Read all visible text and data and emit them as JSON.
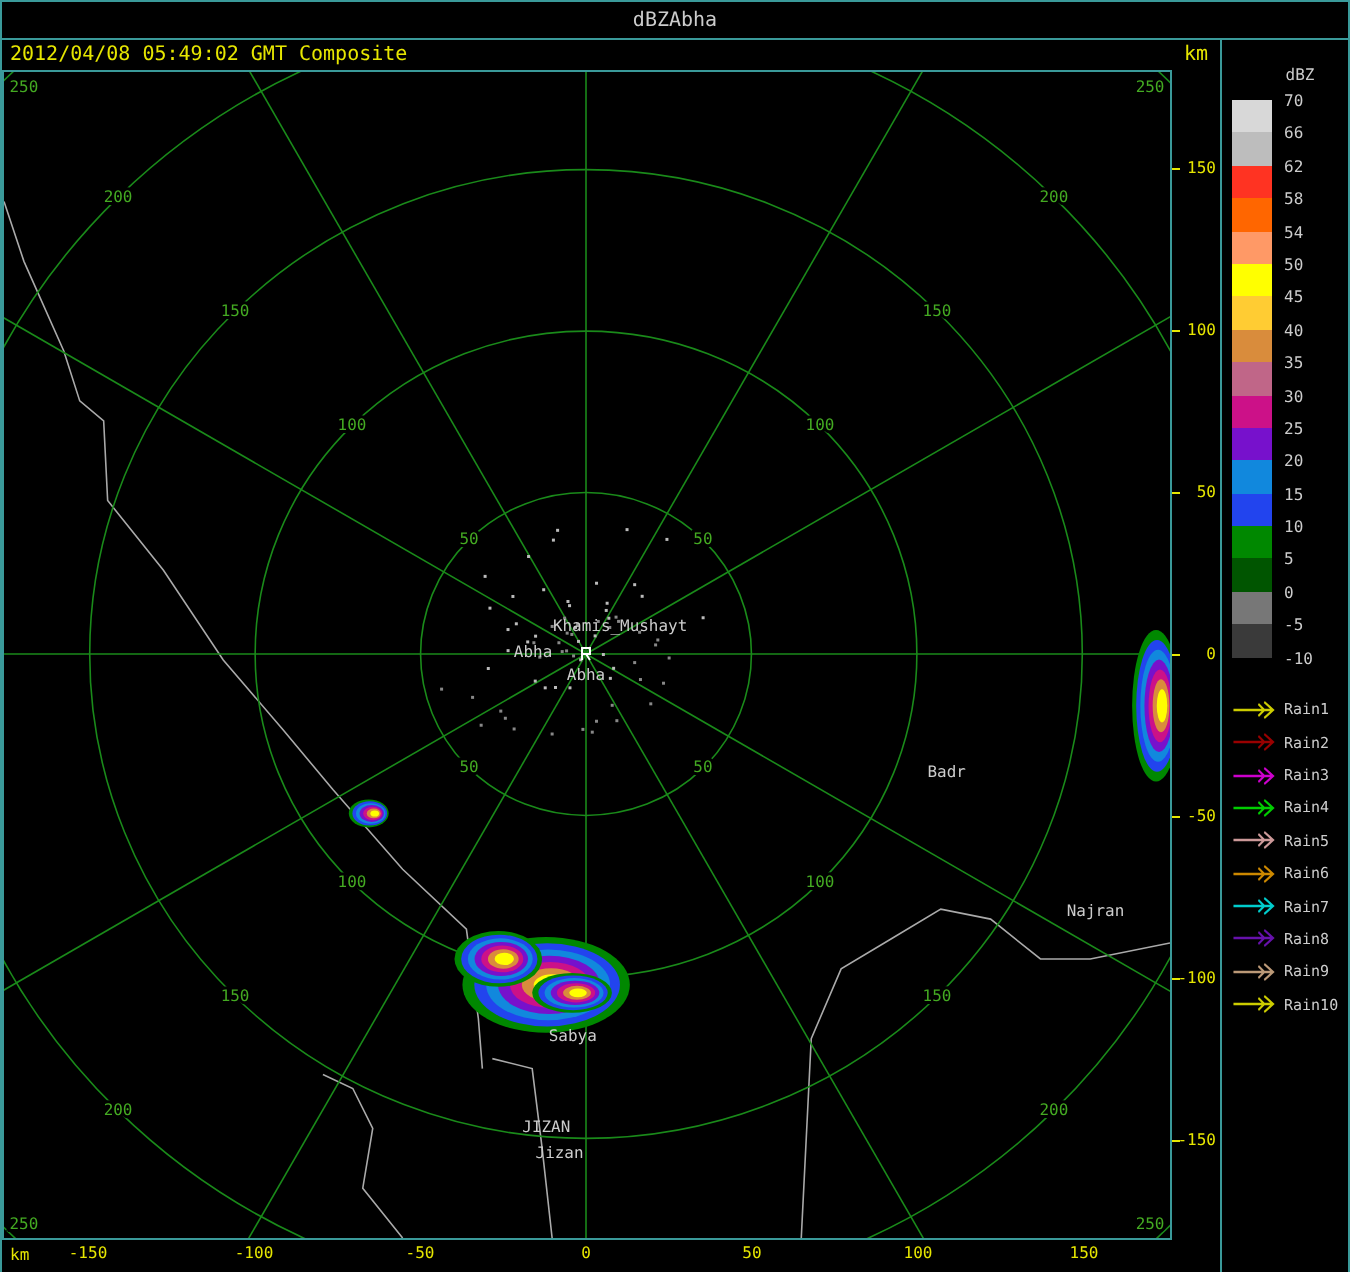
{
  "window": {
    "title": "dBZAbha"
  },
  "header": {
    "timestamp": "2012/04/08 05:49:02 GMT Composite",
    "unit": "km"
  },
  "range_rings": [
    {
      "labels": [
        "50",
        "50",
        "50",
        "50"
      ]
    },
    {
      "labels": [
        "100",
        "100",
        "100",
        "100"
      ]
    },
    {
      "labels": [
        "150",
        "150",
        "150",
        "150"
      ]
    },
    {
      "labels": [
        "200",
        "200",
        "200",
        "200"
      ]
    },
    {
      "labels": [
        "250",
        "250",
        "250",
        "250"
      ]
    }
  ],
  "places": [
    {
      "name": "Khamis_Mushayt"
    },
    {
      "name": "Abha"
    },
    {
      "name": "Abha"
    },
    {
      "name": "Badr"
    },
    {
      "name": "Najran"
    },
    {
      "name": "Sabya"
    },
    {
      "name": "JIZAN"
    },
    {
      "name": "Jizan"
    }
  ],
  "x_axis": {
    "unit": "km",
    "ticks": [
      "-150",
      "-100",
      "-50",
      "0",
      "50",
      "100",
      "150"
    ]
  },
  "y_axis": {
    "ticks": [
      "150",
      "100",
      "50",
      "0",
      "-50",
      "-100",
      "-150"
    ]
  },
  "legend": {
    "title": "dBZ",
    "scale": [
      {
        "label": "70",
        "color": "#d8d8d8"
      },
      {
        "label": "66",
        "color": "#bdbdbd"
      },
      {
        "label": "62",
        "color": "#ff3322"
      },
      {
        "label": "58",
        "color": "#ff6600"
      },
      {
        "label": "54",
        "color": "#ff9966"
      },
      {
        "label": "50",
        "color": "#ffff00"
      },
      {
        "label": "45",
        "color": "#ffcc33"
      },
      {
        "label": "40",
        "color": "#d98c3c"
      },
      {
        "label": "35",
        "color": "#c06688"
      },
      {
        "label": "30",
        "color": "#cc1188"
      },
      {
        "label": "25",
        "color": "#7711cc"
      },
      {
        "label": "20",
        "color": "#1188dd"
      },
      {
        "label": "15",
        "color": "#2244ee"
      },
      {
        "label": "10",
        "color": "#008800"
      },
      {
        "label": "5",
        "color": "#005500"
      },
      {
        "label": "0",
        "color": "#777777"
      },
      {
        "label": "-5",
        "color": "#3a3a3a"
      },
      {
        "label": "-10"
      }
    ],
    "tracks": [
      {
        "label": "Rain1",
        "color": "#cccc00"
      },
      {
        "label": "Rain2",
        "color": "#990000"
      },
      {
        "label": "Rain3",
        "color": "#cc00cc"
      },
      {
        "label": "Rain4",
        "color": "#00cc00"
      },
      {
        "label": "Rain5",
        "color": "#cc9999"
      },
      {
        "label": "Rain6",
        "color": "#cc8800"
      },
      {
        "label": "Rain7",
        "color": "#00cccc"
      },
      {
        "label": "Rain8",
        "color": "#6611aa"
      },
      {
        "label": "Rain9",
        "color": "#bb9977"
      },
      {
        "label": "Rain10",
        "color": "#cccc00"
      }
    ]
  }
}
